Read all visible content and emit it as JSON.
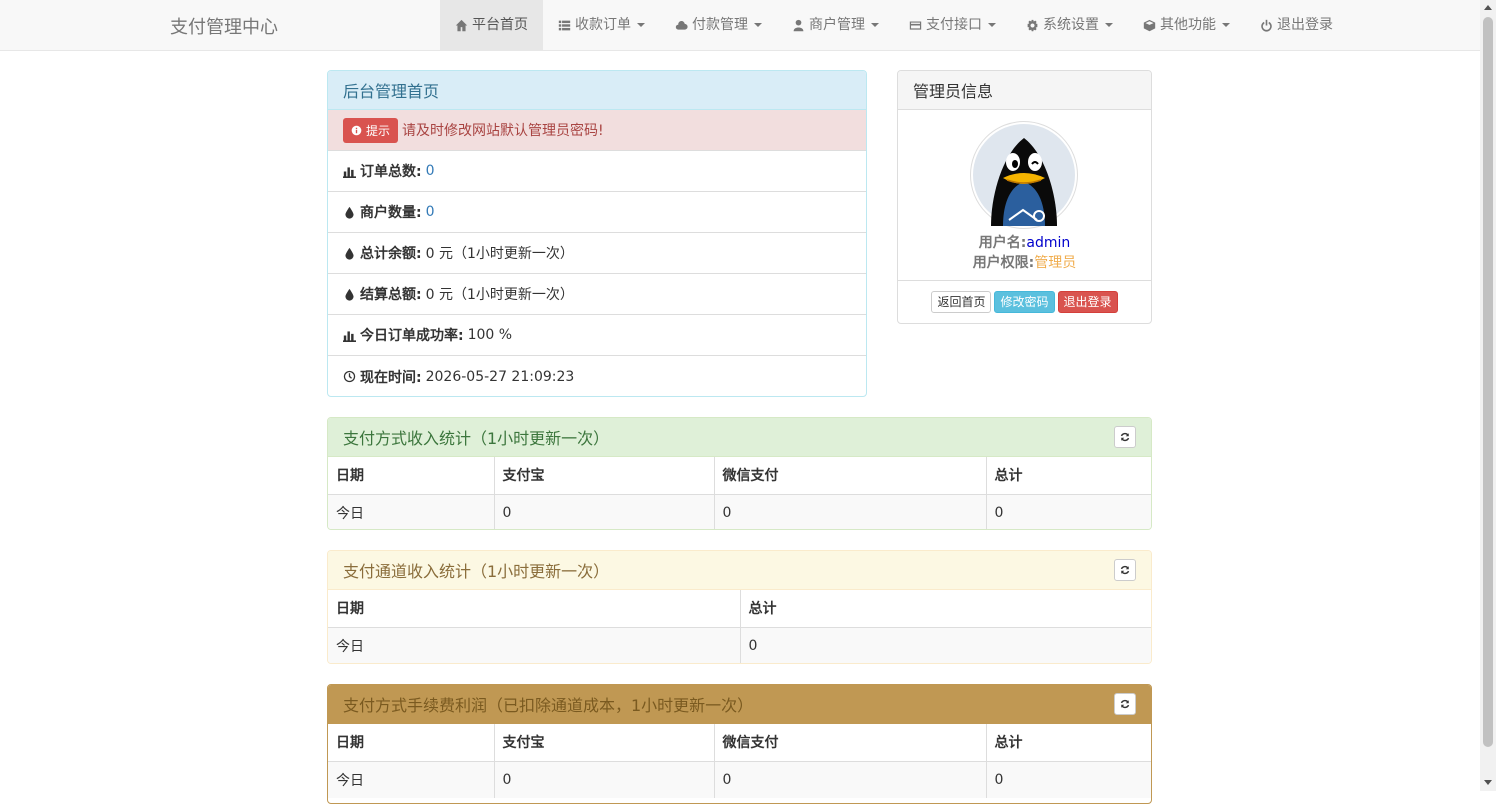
{
  "brand": "支付管理中心",
  "nav": [
    {
      "label": "平台首页",
      "icon": "home-icon",
      "dropdown": false
    },
    {
      "label": "收款订单",
      "icon": "list-icon",
      "dropdown": true
    },
    {
      "label": "付款管理",
      "icon": "cloud-icon",
      "dropdown": true
    },
    {
      "label": "商户管理",
      "icon": "user-icon",
      "dropdown": true
    },
    {
      "label": "支付接口",
      "icon": "credit-card-icon",
      "dropdown": true
    },
    {
      "label": "系统设置",
      "icon": "gear-icon",
      "dropdown": true
    },
    {
      "label": "其他功能",
      "icon": "cube-icon",
      "dropdown": true
    },
    {
      "label": "退出登录",
      "icon": "power-icon",
      "dropdown": false
    }
  ],
  "dashboard": {
    "title": "后台管理首页",
    "alert_label": "提示",
    "alert_text": "请及时修改网站默认管理员密码!",
    "stats": [
      {
        "label": "订单总数:",
        "value": "0",
        "icon": "bar-chart-icon",
        "link": true
      },
      {
        "label": "商户数量:",
        "value": "0",
        "icon": "drop-icon",
        "link": true
      },
      {
        "label": "总计余额:",
        "value": "0 元（1小时更新一次）",
        "icon": "drop-icon",
        "link": false
      },
      {
        "label": "结算总额:",
        "value": "0 元（1小时更新一次）",
        "icon": "drop-icon",
        "link": false
      },
      {
        "label": "今日订单成功率:",
        "value": "100 %",
        "icon": "bar-chart-icon",
        "link": false
      },
      {
        "label": "现在时间:",
        "value": " 2026-05-27 21:09:23",
        "icon": "clock-icon",
        "link": false
      }
    ]
  },
  "admin": {
    "title": "管理员信息",
    "username_label": "用户名:",
    "username": "admin",
    "role_label": "用户权限:",
    "role": "管理员",
    "btn_home": "返回首页",
    "btn_password": "修改密码",
    "btn_logout": "退出登录",
    "colors": {
      "username": "#0000cc",
      "role": "#f0ad4e"
    }
  },
  "method_stats": {
    "title": "支付方式收入统计（1小时更新一次）",
    "headers": [
      "日期",
      "支付宝",
      "微信支付",
      "总计"
    ],
    "rows": [
      [
        "今日",
        "0",
        "0",
        "0"
      ]
    ]
  },
  "channel_stats": {
    "title": "支付通道收入统计（1小时更新一次）",
    "headers": [
      "日期",
      "总计"
    ],
    "rows": [
      [
        "今日",
        "0"
      ]
    ]
  },
  "fee_stats": {
    "title": "支付方式手续费利润（已扣除通道成本，1小时更新一次）",
    "headers": [
      "日期",
      "支付宝",
      "微信支付",
      "总计"
    ],
    "rows": [
      [
        "今日",
        "0",
        "0",
        "0"
      ]
    ]
  }
}
